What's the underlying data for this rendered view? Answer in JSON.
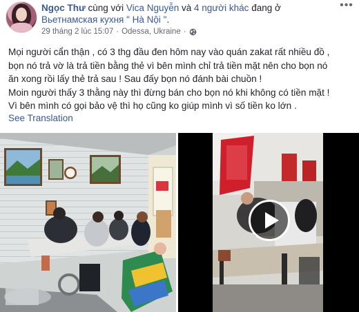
{
  "post": {
    "author": "Ngọc Thư",
    "with_text": " cùng với ",
    "tagged_person": "Vica Nguyễn",
    "and_text": " và ",
    "others": "4 người khác",
    "at_text": " đang ở ",
    "place": "Вьетнамская кухня \" Hà Nội \"",
    "period": ".",
    "timestamp": "29 tháng 2 lúc 15:07",
    "separator": "·",
    "location": "Odessa, Ukraine",
    "location_sep": "·",
    "privacy_icon": "globe-icon",
    "menu_icon": "more-options-icon",
    "menu_glyph": "•••",
    "text_lines": [
      "Mọi người cẩn thận , có 3 thg đầu đen hôm nay vào quán zakat rất nhiều đồ ,",
      "bọn nó trả vờ là trả tiền bằng thẻ vì bên mình chỉ trả tiền mặt nên cho bọn nó",
      "ăn xong rồi lấy thẻ trả sau ! Sau đấy bọn nó đánh bài chuồn !",
      "Moin người thấy 3 thằng này thì đừng bán cho bọn nó khi không có tiền mặt !",
      "Vì bên mình có gọi bảo vệ thì họ cũng ko giúp mình vì số tiền ko lớn ."
    ],
    "see_translation": "See Translation"
  },
  "media": {
    "left_photo": "restaurant-interior-photo",
    "right_video": "video-thumbnail",
    "play_icon": "play-icon"
  },
  "colors": {
    "link": "#385898",
    "text": "#1d2129",
    "meta": "#616770"
  }
}
